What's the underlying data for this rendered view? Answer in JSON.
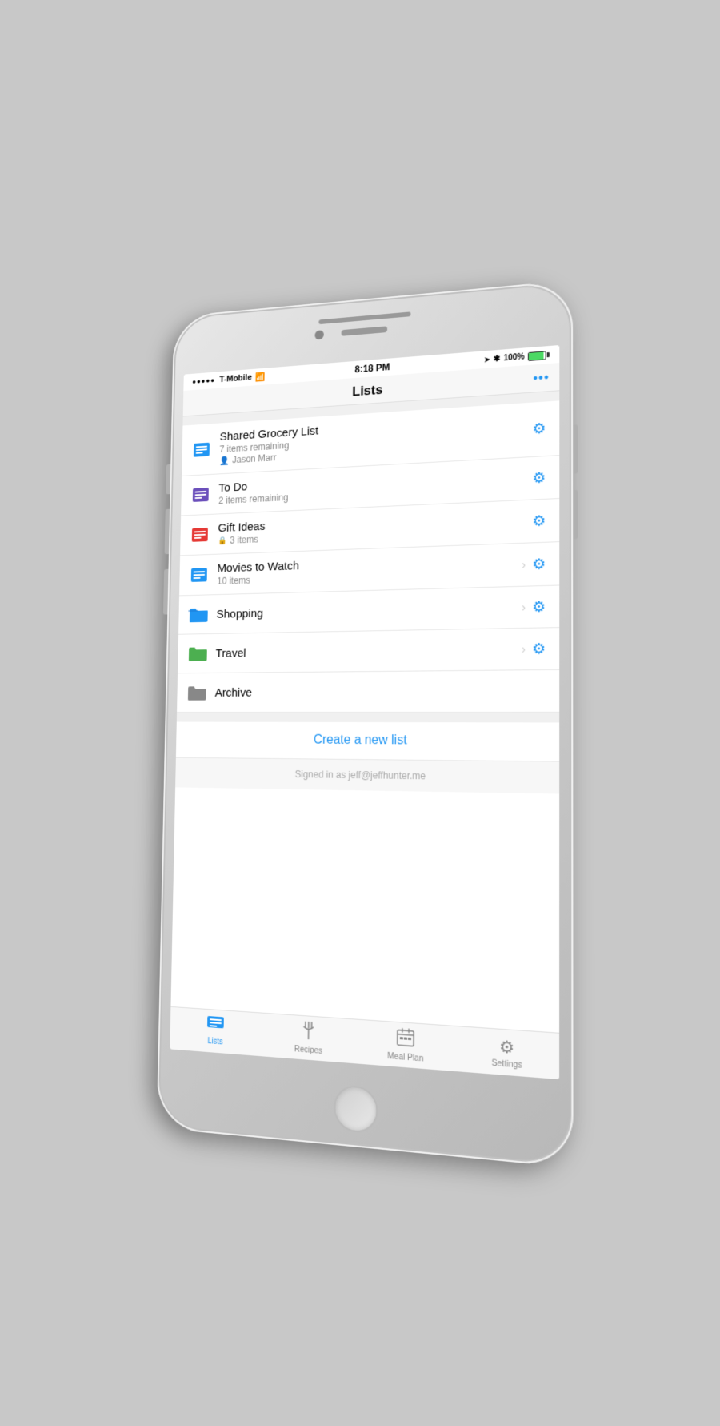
{
  "status_bar": {
    "carrier": "T-Mobile",
    "signal_bars": "●●●●●",
    "wifi_icon": "wifi",
    "time": "8:18 PM",
    "location_icon": "arrow",
    "bluetooth_icon": "bluetooth",
    "battery_percent": "100%",
    "battery_label": "100%"
  },
  "nav": {
    "title": "Lists",
    "more_icon": "•••"
  },
  "sections": {
    "my_lists_label": "",
    "folders_label": ""
  },
  "lists": [
    {
      "id": "shared-grocery",
      "name": "Shared Grocery List",
      "sub": "7 items remaining",
      "person": "Jason Marr",
      "icon_color": "blue",
      "has_gear": true,
      "has_chevron": false
    },
    {
      "id": "to-do",
      "name": "To Do",
      "sub": "2 items remaining",
      "person": "",
      "icon_color": "purple",
      "has_gear": true,
      "has_chevron": false
    },
    {
      "id": "gift-ideas",
      "name": "Gift Ideas",
      "sub": "3 items",
      "person": "",
      "icon_color": "red",
      "has_gear": true,
      "has_chevron": false,
      "locked": true
    },
    {
      "id": "movies-to-watch",
      "name": "Movies to Watch",
      "sub": "10 items",
      "person": "",
      "icon_color": "blue",
      "has_gear": true,
      "has_chevron": true
    }
  ],
  "folders": [
    {
      "id": "shopping",
      "name": "Shopping",
      "icon_color": "blue",
      "has_gear": true,
      "has_chevron": true
    },
    {
      "id": "travel",
      "name": "Travel",
      "icon_color": "green",
      "has_gear": true,
      "has_chevron": true
    },
    {
      "id": "archive",
      "name": "Archive",
      "icon_color": "gray",
      "has_gear": false,
      "has_chevron": false
    }
  ],
  "create_list": {
    "label": "Create a new list"
  },
  "signed_in": {
    "label": "Signed in as jeff@jeffhunter.me"
  },
  "tabs": [
    {
      "id": "lists",
      "label": "Lists",
      "icon": "lists",
      "active": true
    },
    {
      "id": "recipes",
      "label": "Recipes",
      "icon": "recipes",
      "active": false
    },
    {
      "id": "meal-plan",
      "label": "Meal Plan",
      "icon": "meal-plan",
      "active": false
    },
    {
      "id": "settings",
      "label": "Settings",
      "icon": "settings",
      "active": false
    }
  ]
}
